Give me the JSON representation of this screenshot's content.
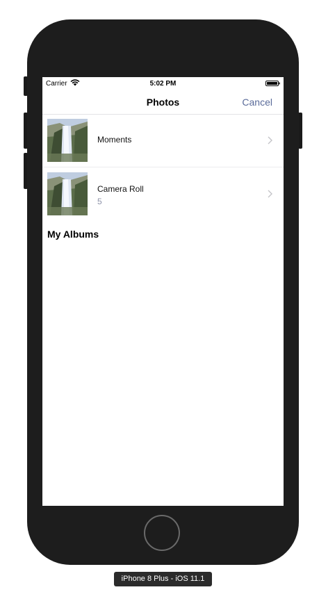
{
  "status_bar": {
    "carrier": "Carrier",
    "time": "5:02 PM"
  },
  "nav": {
    "title": "Photos",
    "cancel_label": "Cancel"
  },
  "rows": [
    {
      "label": "Moments",
      "count": ""
    },
    {
      "label": "Camera Roll",
      "count": "5"
    }
  ],
  "section": {
    "title": "My Albums"
  },
  "device_label": "iPhone 8 Plus - iOS 11.1",
  "colors": {
    "accent": "#5a6b9a",
    "phone_body": "#1d1d1d",
    "count_text": "#8e93a8"
  },
  "icons": {
    "status_bar": [
      "wifi-icon",
      "battery-icon"
    ],
    "rows": [
      "chevron-right-icon"
    ]
  }
}
